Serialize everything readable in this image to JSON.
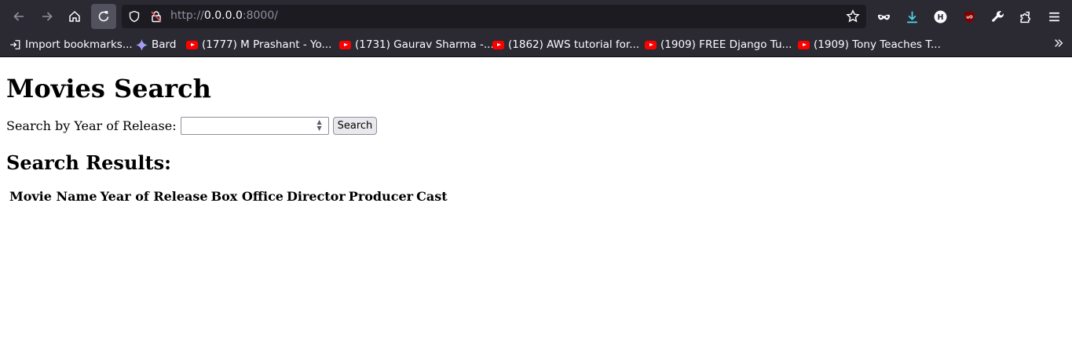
{
  "browser": {
    "url_prefix": "http://",
    "url_host": "0.0.0.0",
    "url_port": ":8000/",
    "bookmarks": [
      {
        "label": "Import bookmarks...",
        "icon": "import-icon"
      },
      {
        "label": "Bard",
        "icon": "bard-icon"
      },
      {
        "label": "(1777) M Prashant - Yo...",
        "icon": "youtube-icon"
      },
      {
        "label": "(1731) Gaurav Sharma -...",
        "icon": "youtube-icon"
      },
      {
        "label": "(1862) AWS tutorial for...",
        "icon": "youtube-icon"
      },
      {
        "label": "(1909) FREE Django Tu...",
        "icon": "youtube-icon"
      },
      {
        "label": "(1909) Tony Teaches T...",
        "icon": "youtube-icon"
      }
    ]
  },
  "page": {
    "title": "Movies Search",
    "search_label": "Search by Year of Release:",
    "search_value": "",
    "search_button": "Search",
    "results_title": "Search Results:",
    "columns": [
      "Movie Name",
      "Year of Release",
      "Box Office",
      "Director",
      "Producer",
      "Cast"
    ]
  }
}
